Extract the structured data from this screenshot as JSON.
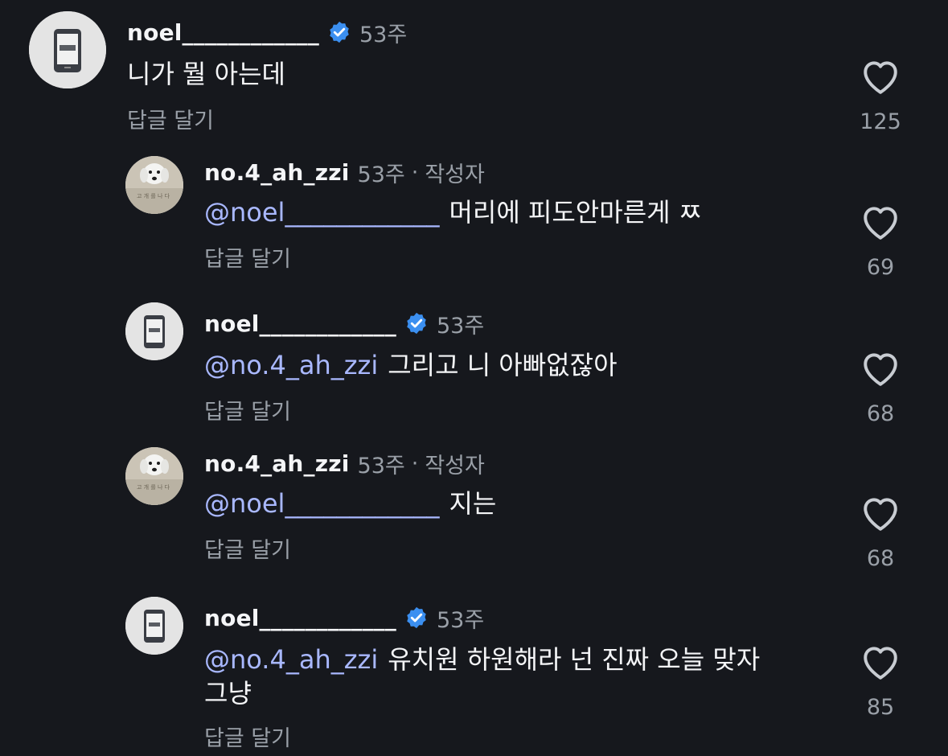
{
  "comments": [
    {
      "username": "noel____________",
      "verified": true,
      "time": "53주",
      "is_author": false,
      "author_label": "",
      "mention": "",
      "text": "니가 뭘 아는데",
      "text_line2": "",
      "reply_label": "답글 달기",
      "likes": "125"
    },
    {
      "username": "no.4_ah_zzi",
      "verified": false,
      "time": "53주",
      "is_author": true,
      "author_label": "작성자",
      "separator": "·",
      "mention": "@noel____________",
      "text": "머리에 피도안마른게 ㅉ",
      "text_line2": "",
      "reply_label": "답글 달기",
      "likes": "69"
    },
    {
      "username": "noel____________",
      "verified": true,
      "time": "53주",
      "is_author": false,
      "author_label": "",
      "mention": "@no.4_ah_zzi",
      "text": "그리고 니 아빠없잖아",
      "text_line2": "",
      "reply_label": "답글 달기",
      "likes": "68"
    },
    {
      "username": "no.4_ah_zzi",
      "verified": false,
      "time": "53주",
      "is_author": true,
      "author_label": "작성자",
      "separator": "·",
      "mention": "@noel____________",
      "text": "지는",
      "text_line2": "",
      "reply_label": "답글 달기",
      "likes": "68"
    },
    {
      "username": "noel____________",
      "verified": true,
      "time": "53주",
      "is_author": false,
      "author_label": "",
      "mention": "@no.4_ah_zzi",
      "text": "유치원 하원해라 넌 진짜 오늘 맞자",
      "text_line2": "그냥",
      "reply_label": "답글 달기",
      "likes": "85"
    }
  ],
  "colors": {
    "background": "#16181d",
    "mention": "#a9b8ff",
    "verified": "#3b8ff0",
    "secondary_text": "#9aa0a8"
  },
  "icons": {
    "verified": "verified-badge-icon",
    "like": "heart-outline-icon",
    "avatar_noel": "phone-screen-avatar",
    "avatar_zzi": "dog-avatar"
  }
}
